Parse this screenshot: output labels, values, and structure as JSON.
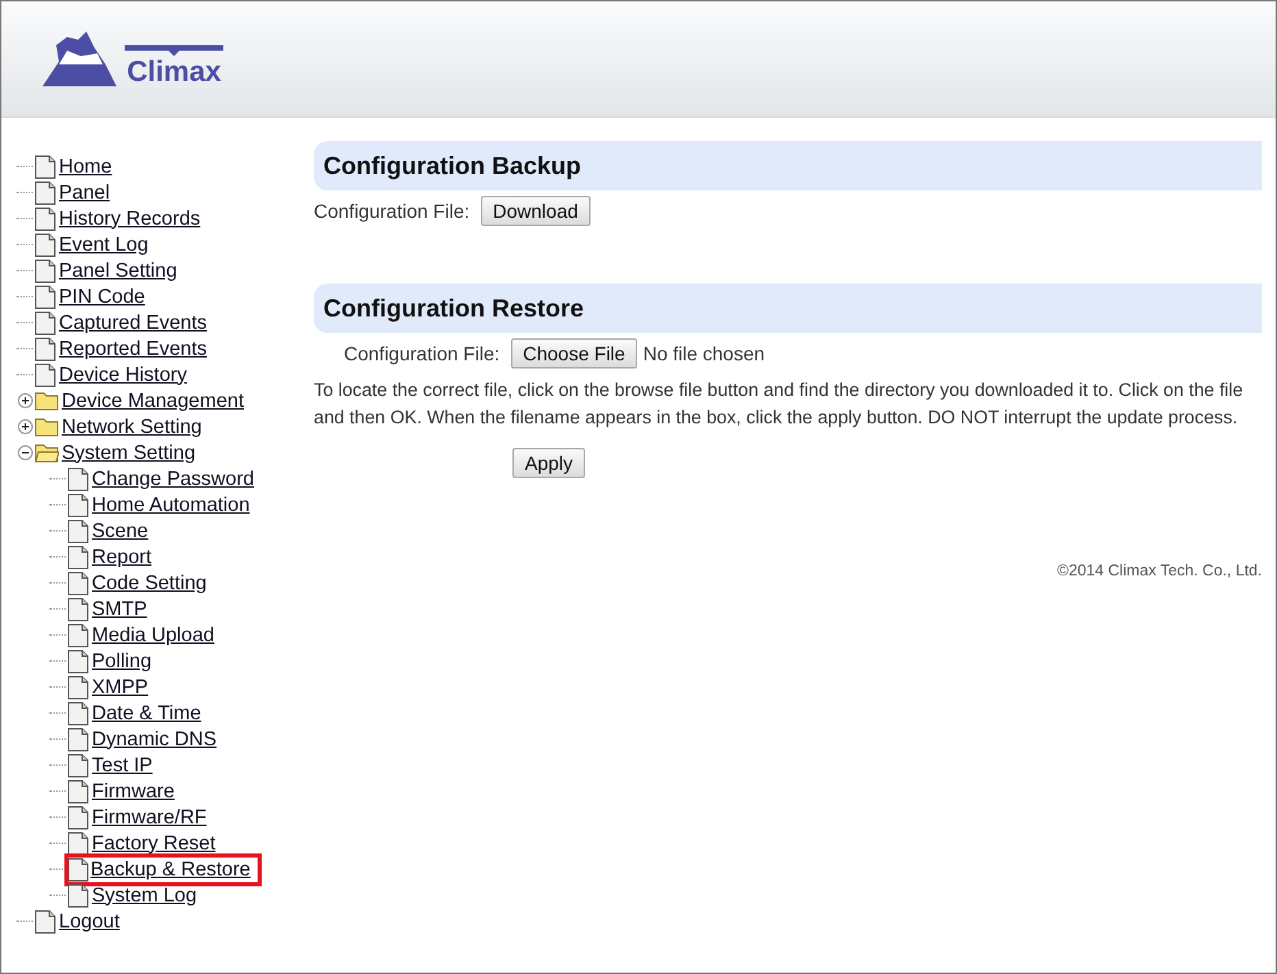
{
  "logo": {
    "text": "Climax"
  },
  "nav": [
    {
      "label": "Home",
      "kind": "page",
      "highlighted": false
    },
    {
      "label": "Panel",
      "kind": "page",
      "highlighted": false
    },
    {
      "label": "History Records",
      "kind": "page",
      "highlighted": false
    },
    {
      "label": "Event Log",
      "kind": "page",
      "highlighted": false
    },
    {
      "label": "Panel Setting",
      "kind": "page",
      "highlighted": false
    },
    {
      "label": "PIN Code",
      "kind": "page",
      "highlighted": false
    },
    {
      "label": "Captured Events",
      "kind": "page",
      "highlighted": false
    },
    {
      "label": "Reported Events",
      "kind": "page",
      "highlighted": false
    },
    {
      "label": "Device History",
      "kind": "page",
      "highlighted": false
    },
    {
      "label": "Device Management",
      "kind": "folder",
      "expanded": false,
      "highlighted": false
    },
    {
      "label": "Network Setting",
      "kind": "folder",
      "expanded": false,
      "highlighted": false
    },
    {
      "label": "System Setting",
      "kind": "folder",
      "expanded": true,
      "highlighted": false,
      "children": [
        {
          "label": "Change Password",
          "kind": "page",
          "highlighted": false
        },
        {
          "label": "Home Automation",
          "kind": "page",
          "highlighted": false
        },
        {
          "label": "Scene",
          "kind": "page",
          "highlighted": false
        },
        {
          "label": "Report",
          "kind": "page",
          "highlighted": false
        },
        {
          "label": "Code Setting",
          "kind": "page",
          "highlighted": false
        },
        {
          "label": "SMTP",
          "kind": "page",
          "highlighted": false
        },
        {
          "label": "Media Upload",
          "kind": "page",
          "highlighted": false
        },
        {
          "label": "Polling",
          "kind": "page",
          "highlighted": false
        },
        {
          "label": "XMPP",
          "kind": "page",
          "highlighted": false
        },
        {
          "label": "Date & Time",
          "kind": "page",
          "highlighted": false
        },
        {
          "label": "Dynamic DNS",
          "kind": "page",
          "highlighted": false
        },
        {
          "label": "Test IP",
          "kind": "page",
          "highlighted": false
        },
        {
          "label": "Firmware",
          "kind": "page",
          "highlighted": false
        },
        {
          "label": "Firmware/RF",
          "kind": "page",
          "highlighted": false
        },
        {
          "label": "Factory Reset",
          "kind": "page",
          "highlighted": false
        },
        {
          "label": "Backup & Restore",
          "kind": "page",
          "highlighted": true
        },
        {
          "label": "System Log",
          "kind": "page",
          "highlighted": false
        }
      ]
    },
    {
      "label": "Logout",
      "kind": "page",
      "highlighted": false
    }
  ],
  "backup": {
    "title": "Configuration Backup",
    "label": "Configuration File:",
    "button": "Download"
  },
  "restore": {
    "title": "Configuration Restore",
    "label": "Configuration File:",
    "choose_button": "Choose File",
    "file_status": "No file chosen",
    "help": "To locate the correct file, click on the browse file button and find the directory you downloaded it to. Click on the file and then OK. When the filename appears in the box, click the apply button. DO NOT interrupt the update process.",
    "apply_button": "Apply"
  },
  "footer": "©2014 Climax Tech. Co., Ltd."
}
